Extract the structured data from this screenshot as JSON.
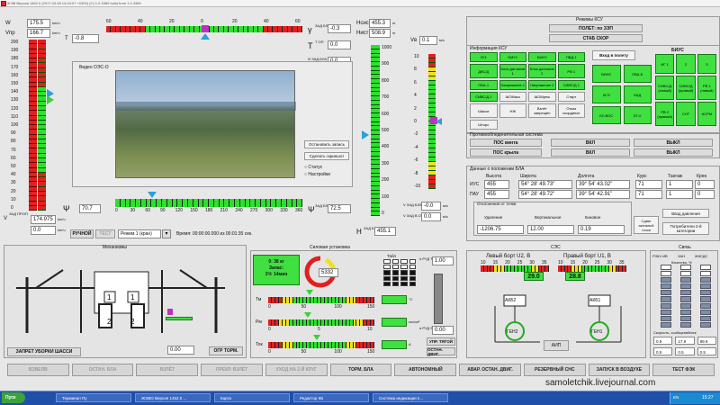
{
  "window": {
    "title": "ЖЭВ Версия 1452.0 (2017.03.08 14:04:07 +0300) (C) 1.0.3389 build from 1.0.3389"
  },
  "left": {
    "w_label": "W",
    "w_value": "175.5",
    "w_unit": "km/ч",
    "vpr_label": "Vпр",
    "vpr_value": "166.7",
    "vpr_unit": "km/ч",
    "t_label": "T",
    "t_value": "-0.8",
    "v_label": "V",
    "v_zad_label": "ЗАД ПР.ОП",
    "v_value": "174.975",
    "v_unit": "km/ч",
    "v_zad_value": "0.0",
    "v_zad_unit": "km/ч",
    "scale": [
      "200",
      "190",
      "180",
      "170",
      "160",
      "150",
      "140",
      "130",
      "120",
      "110",
      "100",
      "90",
      "80",
      "70",
      "60",
      "50",
      "40",
      "30",
      "20",
      "10",
      "0"
    ]
  },
  "gamma": {
    "label": "γ",
    "value": "-0.3",
    "ticks": [
      "60",
      "40",
      "20",
      "0",
      "20",
      "40",
      "60"
    ],
    "zad_label": "ЗАД БЛА",
    "zad_value": "-0.3",
    "t_op_label": "Т ОП",
    "t_op_value": "0.0",
    "theta_label": "Θ ЗАД БЛА",
    "theta_value": "0.0"
  },
  "height": {
    "h_ist_label": "Нсис",
    "h_ist_value": "455.3",
    "h_ist_unit": "m",
    "h_nist_label": "Нист",
    "h_nist_value": "508.9",
    "h_nist_unit": "m",
    "scale": [
      "1000",
      "900",
      "800",
      "700",
      "600",
      "500",
      "400",
      "300",
      "200",
      "100",
      "0"
    ],
    "h_label": "H",
    "h_zad_label": "ЗАД БЛА",
    "h_value": "455.1"
  },
  "vy": {
    "label": "Vв",
    "value": "0.1",
    "unit": "м/с",
    "scale": [
      "10",
      "8",
      "6",
      "4",
      "2",
      "0",
      "-2",
      "-4",
      "-6",
      "-8",
      "-10"
    ],
    "zad1_label": "V ЗАД БЛА",
    "zad1_value": "-0.0",
    "zad1_unit": "м/с",
    "zad2_label": "V ЗАД В.ОП",
    "zad2_value": "0.0",
    "zad2_unit": "м/с"
  },
  "video": {
    "title": "Видео ОЭС-О",
    "stop_btn": "Остановить запись",
    "screenshot_btn": "Сделать скриншот",
    "opt1": "Статус",
    "opt2": "Настройки"
  },
  "psi": {
    "label": "Ψ",
    "value": "70.7",
    "zad_label": "ЗАД БЛА",
    "zad_value": "72.5",
    "ticks": [
      "0",
      "30",
      "60",
      "90",
      "120",
      "150",
      "180",
      "210",
      "240",
      "270",
      "300",
      "330",
      "360"
    ]
  },
  "mode": {
    "manual_btn": "РУЧНОЙ",
    "test_btn": "ТЕСТ",
    "mode_select": "Режим 1 (кран)",
    "time_text": "Время: 00:00:00.000 из 00:01:35 сек."
  },
  "ksu": {
    "title": "Режимы КСУ",
    "btn_flight": "ПОЛЕТ: по ЗЭП",
    "btn_stab": "СТАБ СКОР",
    "info_title": "Информация КСУ",
    "grid": [
      "ЗУ1",
      "БМУ1",
      "БМУ2",
      "ПВД-1",
      "ДВС/Д",
      "Блок датчиков 1",
      "Блок датчиков 2",
      "РВ 1",
      "ПВА-1",
      "Напряжение 1",
      "Напряжение 2",
      "СИВС/Д 1",
      "СИВС/Д 2",
      "ШОМаск",
      "ШОМреж",
      "Старт",
      "Шасси",
      "НЖ",
      "Взлёт запрещён",
      "Отказ координат",
      "Шторс"
    ],
    "mid_btn": "Вход в полету",
    "mid_grid": [
      "ВИНС",
      "ПВА-Б",
      "КСЭ",
      "КАД",
      "БЛ-ВОС",
      "БГ-0"
    ],
    "bius_title": "БИУС",
    "bius": [
      "ИГ 1",
      "2",
      "3",
      "СИВС/Д (левый)",
      "СИВС/Д (правый)",
      "РВ 1 (левый)",
      "РВ 2 (правый)",
      "СНТ",
      "АСРМ"
    ]
  },
  "anti_ice": {
    "title": "Противообледенительная система",
    "rows": [
      {
        "label": "ПОС винта",
        "on": "ВКЛ",
        "off": "ВЫКЛ"
      },
      {
        "label": "ПОС крыла",
        "on": "ВКЛ",
        "off": "ВЫКЛ"
      }
    ]
  },
  "position": {
    "title": "Данные о положении БЛА",
    "headers": [
      "Высота",
      "Широта",
      "Долгота",
      "Курс",
      "Тангаж",
      "Крен"
    ],
    "rows": [
      {
        "name": "ИУС",
        "values": [
          "455",
          "54° 28' 49.73\"",
          "39° 54' 43.02\"",
          "71",
          "1",
          "0"
        ]
      },
      {
        "name": "ПАУ",
        "values": [
          "455",
          "54° 28' 49.72\"",
          "39° 54' 42.91\"",
          "71",
          "1",
          "0"
        ]
      }
    ],
    "dev_title": "Отклонения от точки",
    "dev_headers": [
      "Удаление",
      "Вертикальное",
      "Боковое"
    ],
    "dev_values": [
      "-1206.75",
      "12.00",
      "0.19"
    ],
    "btn_point": "Сдвиг активной точки",
    "btn_pressure": "Ввод давления",
    "btn_consumers": "Потребители 2-й категории"
  },
  "mech": {
    "title": "Механизмы",
    "gear_btn": "ЗАПРЕТ УБОРКИ ШАССИ",
    "brake_value": "0.00",
    "brake_btn": "ОГР ТОРМ."
  },
  "power": {
    "title": "Силовая установка",
    "fuel_lbl": "0: 38 кг",
    "fuel_lbl2": "Запас:",
    "fuel_lbl3": "1Ч: 14мин",
    "rpm_value": "5332",
    "tm_label": "Тм",
    "pm_label": "Рм",
    "tok_label": "Ток",
    "tm_ticks": [
      "0",
      "50",
      "100",
      "150"
    ],
    "pm_ticks": [
      "0",
      "5",
      "10"
    ],
    "tok_ticks": [
      "0",
      "50",
      "100",
      "150"
    ],
    "tm_unit": "°С",
    "pm_unit": "кгс/см²",
    "tok_unit": "А",
    "other_title": "Табл",
    "alpha_label": "α РУД ТОР",
    "alpha_value": "1.00",
    "alpha2_label": "α РУД ЗАД",
    "alpha2_value": "0.00",
    "btn1": "УПР. ТЯГОЙ",
    "btn2": "ОСТАН. ДВИГ."
  },
  "sec": {
    "title": "СЭС",
    "left_label": "Левый борт U2, В",
    "right_label": "Правый борт U1, В",
    "left_ticks": [
      "10",
      "15",
      "20",
      "25",
      "30",
      "35"
    ],
    "right_ticks": [
      "10",
      "15",
      "20",
      "25",
      "30",
      "35"
    ],
    "left_value": "29.0",
    "right_value": "28.8",
    "akb2": "АКБ2",
    "akb1": "АКБ1",
    "gen2": "ГЕН2",
    "gen1": "ГЕН1",
    "aip": "АИП"
  },
  "comm": {
    "title": "Связь",
    "cols": [
      "РЗКХ ИВ",
      "ЗАН",
      "ЖКСДС"
    ],
    "quality": "Качество, %",
    "speed_lbl": "Скорость, сообщений/сек",
    "speed_vals": [
      "0.9",
      "17.9",
      "89.9"
    ],
    "err_vals": [
      "0.5",
      "0.5",
      "0.5"
    ]
  },
  "bottom": {
    "buttons": [
      {
        "label": "ВЗВЕЯВ",
        "enabled": false
      },
      {
        "label": "ОСТАН. БЛА",
        "enabled": false
      },
      {
        "label": "ВЗЛЁТ",
        "enabled": false
      },
      {
        "label": "ПРЕКР. ВЗЛЁТ",
        "enabled": false
      },
      {
        "label": "УХОД НА 2-Й КРУГ",
        "enabled": false
      },
      {
        "label": "ТОРМ. БЛА",
        "enabled": true
      },
      {
        "label": "АВТОНОМНЫЙ",
        "enabled": true
      },
      {
        "label": "АВАР. ОСТАН. ДВИГ.",
        "enabled": true
      },
      {
        "label": "РЕЗЕРВНЫЙ СНС",
        "enabled": true
      },
      {
        "label": "ЗАПУСК В ВОЗДУХЕ",
        "enabled": true
      },
      {
        "label": "ТЕСТ ФЭК",
        "enabled": true
      }
    ]
  },
  "watermark": "samoletchik.livejournal.com",
  "taskbar": {
    "start": "Пуск",
    "items": [
      "Терминал Пу",
      "ЖЭВО Версия 1452.0 ...",
      "Карта",
      "Редактор КБ",
      "Система индикации п..."
    ],
    "clock": "15:27",
    "lang": "EN"
  }
}
